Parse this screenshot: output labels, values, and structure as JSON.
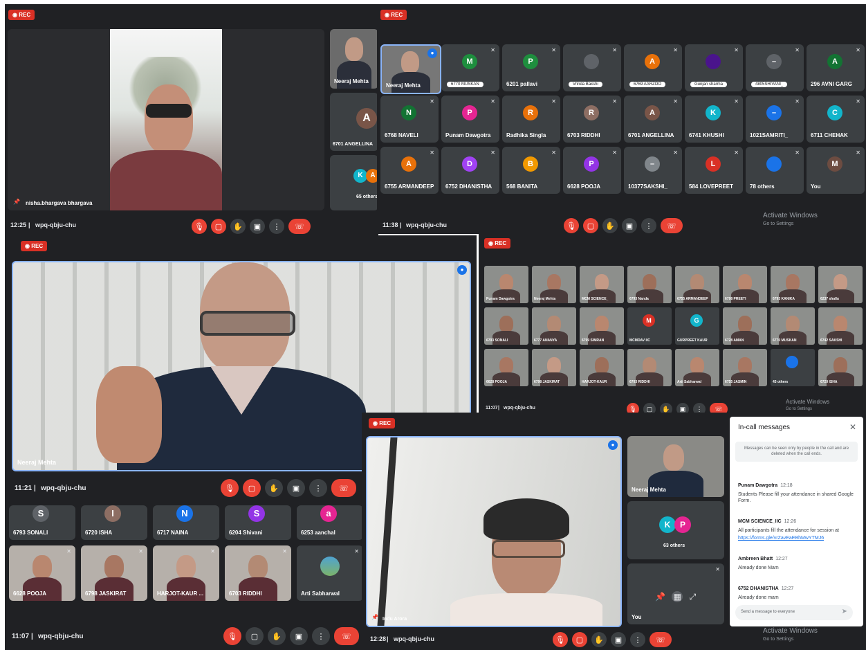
{
  "rec_label": "REC",
  "meeting_code": "wpq-qbju-chu",
  "watermark": {
    "line1": "Activate Windows",
    "line2": "Go to Settings"
  },
  "panel1": {
    "time": "12:25",
    "main_name": "nisha.bhargava bhargava",
    "side": [
      {
        "name": "Neeraj Mehta"
      },
      {
        "name": "6701 ANGELLINA",
        "initial": "A"
      },
      {
        "name": "65 others",
        "initials": [
          "K",
          "A"
        ]
      }
    ]
  },
  "panel2": {
    "time": "11:38",
    "tiles": [
      {
        "name": "Neeraj Mehta",
        "video": true
      },
      {
        "name": "6770 MUSKAN",
        "initial": "M",
        "color": "#1e8e3e",
        "pill": true
      },
      {
        "name": "6201 pallavi",
        "initial": "P",
        "color": "#1e8e3e"
      },
      {
        "name": "Vrinda Bakshi",
        "initial": "",
        "color": "#5f6368",
        "pill": true
      },
      {
        "name": "6769 AARZOO",
        "initial": "A",
        "color": "#e8710a",
        "pill": true
      },
      {
        "name": "Gunjan sharma",
        "initial": "",
        "color": "#4a148c",
        "pill": true
      },
      {
        "name": "4805SHIVANI_",
        "initial": "–",
        "color": "#5f6368",
        "pill": true
      },
      {
        "name": "296 AVNI GARG",
        "initial": "A",
        "color": "#137333"
      },
      {
        "name": "6768 NAVELI",
        "initial": "N",
        "color": "#137333"
      },
      {
        "name": "Punam Dawgotra",
        "initial": "P",
        "color": "#e52592"
      },
      {
        "name": "Radhika Singla",
        "initial": "R",
        "color": "#e8710a"
      },
      {
        "name": "6703 RIDDHI",
        "initial": "R",
        "color": "#8d6e63"
      },
      {
        "name": "6701 ANGELLINA",
        "initial": "A",
        "color": "#795548"
      },
      {
        "name": "6741 KHUSHI",
        "initial": "K",
        "color": "#12b5cb"
      },
      {
        "name": "1021SAMRITI_",
        "initial": "–",
        "color": "#1a73e8"
      },
      {
        "name": "6711 CHEHAK",
        "initial": "C",
        "color": "#12b5cb"
      },
      {
        "name": "6755 ARMANDEEP",
        "initial": "A",
        "color": "#e8710a"
      },
      {
        "name": "6752 DHANISTHA",
        "initial": "D",
        "color": "#a142f4"
      },
      {
        "name": "568 BANITA",
        "initial": "B",
        "color": "#f29900"
      },
      {
        "name": "6628 POOJA",
        "initial": "P",
        "color": "#9334e6"
      },
      {
        "name": "10377SAKSHI_",
        "initial": "–",
        "color": "#80868b"
      },
      {
        "name": "584 LOVEPREET",
        "initial": "L",
        "color": "#d93025"
      },
      {
        "name": "78 others",
        "initial": "",
        "color": "#1a73e8"
      },
      {
        "name": "You",
        "initial": "M",
        "color": "#6d4c41"
      }
    ]
  },
  "panel3": {
    "time": "11:21",
    "main_name": "Neeraj Mehta"
  },
  "panel4": {
    "time": "11:07",
    "tiles": [
      {
        "name": "Punam Dawgotra"
      },
      {
        "name": "Neeraj Mehta"
      },
      {
        "name": "MCM SCIENCE_"
      },
      {
        "name": "6793 Nanda"
      },
      {
        "name": "6755 ARMANDEEP"
      },
      {
        "name": "6798 PREETI"
      },
      {
        "name": "6793 KANIKA"
      },
      {
        "name": "6237 shallu"
      },
      {
        "name": "6793 SONALI"
      },
      {
        "name": "6777 ANANYA"
      },
      {
        "name": "6799 SIMRAN"
      },
      {
        "name": "MCMDAV IIC",
        "initial": "M",
        "color": "#d93025"
      },
      {
        "name": "GURPREET KAUR",
        "initial": "G",
        "color": "#12b5cb"
      },
      {
        "name": "6728 AMAN"
      },
      {
        "name": "6770 MUSKAN"
      },
      {
        "name": "6742 SAKSHI"
      },
      {
        "name": "6628 POOJA"
      },
      {
        "name": "6798 JASKIRAT"
      },
      {
        "name": "HARJOT-KAUR"
      },
      {
        "name": "6703 RIDDHI"
      },
      {
        "name": "Arti Sabharwal"
      },
      {
        "name": "6755 JASMIN"
      },
      {
        "name": "43 others",
        "initial": "",
        "color": "#1a73e8"
      },
      {
        "name": "6720 ISHA"
      }
    ]
  },
  "panel5": {
    "time": "11:07",
    "row1": [
      {
        "name": "6793 SONALI",
        "initial": "S",
        "color": "#5f6368"
      },
      {
        "name": "6720 ISHA",
        "initial": "I",
        "color": "#8d6e63"
      },
      {
        "name": "6717 NAINA",
        "initial": "N",
        "color": "#1a73e8"
      },
      {
        "name": "6204 Shivani",
        "initial": "S",
        "color": "#9334e6"
      },
      {
        "name": "6253 aanchal",
        "initial": "a",
        "color": "#e52592"
      }
    ],
    "row2": [
      {
        "name": "6628 POOJA"
      },
      {
        "name": "6798 JASKIRAT"
      },
      {
        "name": "HARJOT-KAUR ..."
      },
      {
        "name": "6703 RIDDHI"
      },
      {
        "name": "Arti Sabharwal"
      }
    ]
  },
  "panel6": {
    "time": "12:28",
    "main_name": "Indu Arora",
    "side": [
      {
        "name": "Neeraj Mehta"
      },
      {
        "name": "63 others",
        "initials": [
          "K",
          "P"
        ]
      },
      {
        "name": "You"
      }
    ],
    "chat": {
      "title": "In-call messages",
      "note": "Messages can be seen only by people in the call and are deleted when the call ends.",
      "messages": [
        {
          "sender": "Punam Dawgotra",
          "time": "12:18",
          "text": "Students Please fill your attendance in shared Google Form."
        },
        {
          "sender": "MCM SCIENCE_IIC",
          "time": "12:26",
          "text": "All participants fill the attendance for session at",
          "link": "https://forms.gle/vrZavEaEBhMwYTMJ6"
        },
        {
          "sender": "Ambreen Bhatt",
          "time": "12:27",
          "text": "Already done Mam"
        },
        {
          "sender": "6752 DHANISTHA",
          "time": "12:27",
          "text": "Already done mam"
        }
      ],
      "placeholder": "Send a message to everyone"
    }
  }
}
